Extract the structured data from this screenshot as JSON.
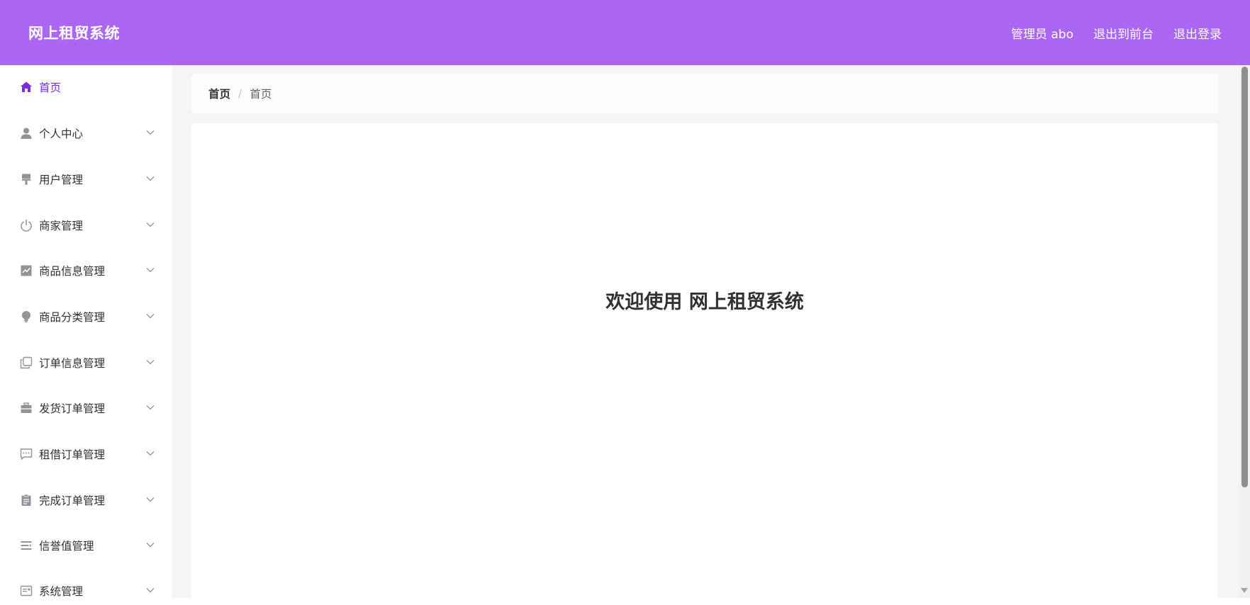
{
  "header": {
    "title": "网上租贸系统",
    "user": "管理员 abo",
    "to_front": "退出到前台",
    "logout": "退出登录"
  },
  "sidebar": {
    "items": [
      {
        "label": "首页",
        "icon": "home-icon",
        "active": true
      },
      {
        "label": "个人中心",
        "icon": "user-icon"
      },
      {
        "label": "用户管理",
        "icon": "brush-icon"
      },
      {
        "label": "商家管理",
        "icon": "power-icon"
      },
      {
        "label": "商品信息管理",
        "icon": "chart-icon"
      },
      {
        "label": "商品分类管理",
        "icon": "opportunity-icon"
      },
      {
        "label": "订单信息管理",
        "icon": "copy-document-icon"
      },
      {
        "label": "发货订单管理",
        "icon": "suitcase-icon"
      },
      {
        "label": "租借订单管理",
        "icon": "chat-dots-icon"
      },
      {
        "label": "完成订单管理",
        "icon": "clipboard-icon"
      },
      {
        "label": "信誉值管理",
        "icon": "list-icon"
      },
      {
        "label": "系统管理",
        "icon": "postcard-icon"
      }
    ]
  },
  "breadcrumb": {
    "first": "首页",
    "separator": "/",
    "current": "首页"
  },
  "content": {
    "welcome": "欢迎使用 网上租贸系统"
  },
  "colors": {
    "header_bg": "#ab66f4",
    "active_text": "#7c2ed6",
    "icon_gray": "#909399"
  }
}
